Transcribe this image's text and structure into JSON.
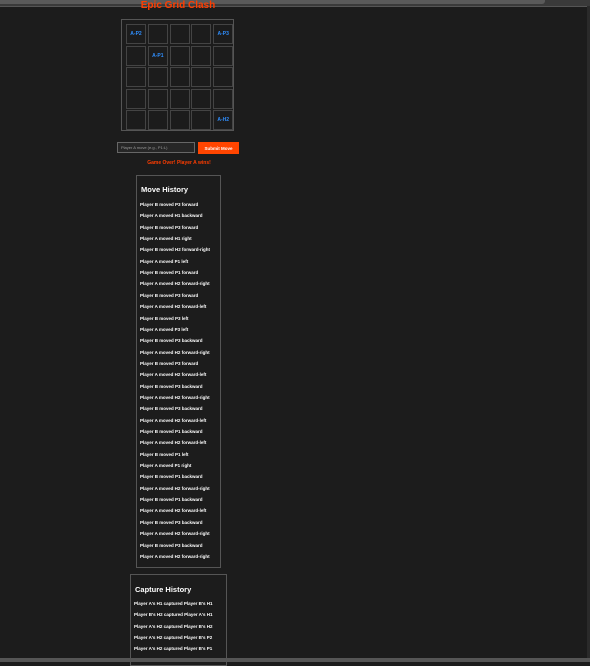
{
  "app": {
    "title": "Epic Grid Clash"
  },
  "board": {
    "rows": [
      [
        "A-P2",
        "",
        "",
        "",
        "A-P3"
      ],
      [
        "",
        "A-P1",
        "",
        "",
        ""
      ],
      [
        "",
        "",
        "",
        "",
        ""
      ],
      [
        "",
        "",
        "",
        "",
        ""
      ],
      [
        "",
        "",
        "",
        "",
        "A-H2"
      ]
    ]
  },
  "move_form": {
    "placeholder": "Player A move (e.g., P1:L)",
    "submit_label": "Submit Move"
  },
  "status": {
    "message": "Game Over! Player A wins!"
  },
  "move_history": {
    "title": "Move History",
    "entries": [
      "Player B moved P3 forward",
      "Player A moved H1 backward",
      "Player B moved P3 forward",
      "Player A moved H1 right",
      "Player B moved H2 forward-right",
      "Player A moved P1 left",
      "Player B moved P1 forward",
      "Player A moved H2 forward-right",
      "Player B moved P3 forward",
      "Player A moved H2 forward-left",
      "Player B moved P3 left",
      "Player A moved P3 left",
      "Player B moved P3 backward",
      "Player A moved H2 forward-right",
      "Player B moved P3 forward",
      "Player A moved H2 forward-left",
      "Player B moved P3 backward",
      "Player A moved H2 forward-right",
      "Player B moved P3 backward",
      "Player A moved H2 forward-left",
      "Player B moved P1 backward",
      "Player A moved H2 forward-left",
      "Player B moved P1 left",
      "Player A moved P1 right",
      "Player B moved P1 backward",
      "Player A moved H2 forward-right",
      "Player B moved P1 backward",
      "Player A moved H2 forward-left",
      "Player B moved P3 backward",
      "Player A moved H2 forward-right",
      "Player B moved P3 backward",
      "Player A moved H2 forward-right"
    ]
  },
  "capture_history": {
    "title": "Capture History",
    "entries": [
      "Player A's H1 captured Player B's H1",
      "Player B's H2 captured Player A's H1",
      "Player A's H2 captured Player B's H2",
      "Player A's H2 captured Player B's P2",
      "Player A's H2 captured Player B's P1"
    ]
  },
  "colors": {
    "background": "#1c1c1c",
    "accent": "#ff4500",
    "piece_label": "#2f8fff"
  }
}
